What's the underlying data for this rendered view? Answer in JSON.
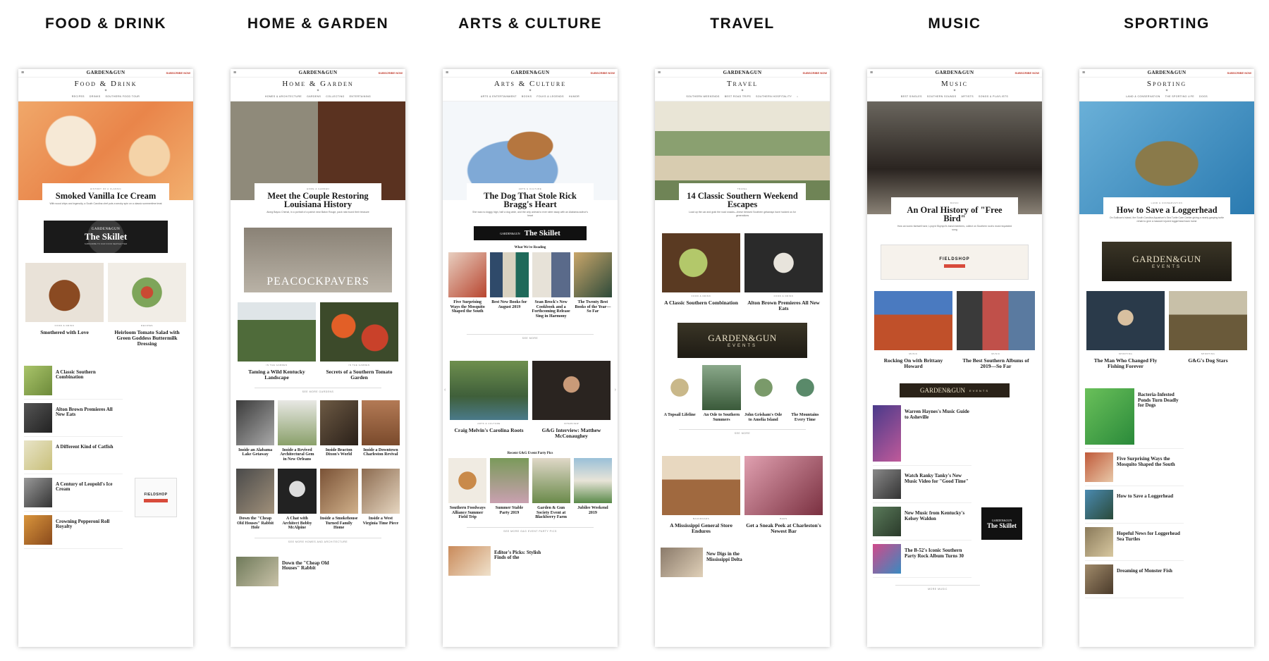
{
  "categories": [
    "FOOD & DRINK",
    "HOME & GARDEN",
    "ARTS & CULTURE",
    "TRAVEL",
    "MUSIC",
    "SPORTING"
  ],
  "brand": {
    "logo": "GARDEN&GUN",
    "subscribe": "SUBSCRIBE NOW",
    "menu": "≡"
  },
  "food": {
    "section": "Food & Drink",
    "subnav": [
      "RECIPES",
      "DRINKS",
      "SOUTHERN FOOD TOUR"
    ],
    "hero_kicker": "HISTORY OF A CLASSIC",
    "hero_title": "Smoked Vanilla Ice Cream",
    "hero_dek": "With wood chips and ingenuity, a South Carolina chef puts a smoky spin on a classic summertime treat",
    "ad_top": "GARDEN&GUN",
    "ad_main": "The Skillet",
    "ad_sub": "SUBSCRIBE TO OUR FOOD NEWSLETTER",
    "tile1_title": "Smothered with Love",
    "tile1_kicker": "FOOD & DRINK",
    "tile2_title": "Heirloom Tomato Salad with Green Goddess Buttermilk Dressing",
    "tile2_kicker": "RECIPES",
    "side_ad": "FIELDSHOP",
    "list": [
      "A Classic Southern Combination",
      "Alton Brown Premieres All New Eats",
      "A Different Kind of Catfish",
      "A Century of Leopold's Ice Cream",
      "Crowning Pepperoni Roll Royalty"
    ]
  },
  "home": {
    "section": "Home & Garden",
    "subnav": [
      "HOMES & ARCHITECTURE",
      "GARDENS",
      "COLLECTING",
      "ENTERTAINING"
    ],
    "hero_kicker": "HOME & GARDEN",
    "hero_title": "Meet the Couple Restoring Louisiana History",
    "hero_dek": "Along Bayou Chenal, in a portrait of a parish near Baton Rouge, pack rats found their treasure",
    "ad_text": "PEACOCKPAVERS",
    "tile1_title": "Taming a Wild Kentucky Landscape",
    "tile1_kicker": "IN THE GARDEN",
    "tile2_title": "Secrets of a Southern Tomato Garden",
    "tile2_kicker": "IN THE GARDEN",
    "more1": "SEE MORE GARDENS",
    "row1": [
      "Inside an Alabama Lake Getaway",
      "Inside a Revived Architectural Gem in New Orleans",
      "Inside Bracton Dixon's World",
      "Inside a Downtown Charleston Revival"
    ],
    "row2": [
      "Down the \"Cheap Old Houses\" Rabbit Hole",
      "A Chat with Architect Bobby McAlpine",
      "Inside a Smokehouse Turned Family Home",
      "Inside a West Virginia Time Piece"
    ],
    "more2": "SEE MORE HOMES AND ARCHITECTURE",
    "bottom_title": "Down the \"Cheap Old Houses\" Rabbit"
  },
  "arts": {
    "section": "Arts & Culture",
    "subnav": [
      "ARTS & ENTERTAINMENT",
      "BOOKS",
      "FOLKS & LEGENDS",
      "HUMOR"
    ],
    "hero_kicker": "ARTS & CULTURE",
    "hero_title": "The Dog That Stole Rick Bragg's Heart",
    "hero_dek": "She was no doggy high, half a dog wide, and the only animal to ever steer away with an Alabama author's heart",
    "ad_top": "GARDEN&GUN",
    "ad_main": "The Skillet",
    "reading_label": "What We're Reading",
    "reading": [
      "Five Surprising Ways the Mosquito Shaped the South",
      "Best New Books for August 2019",
      "Sean Brock's New Cookbook and a Forthcoming Release Sing in Harmony",
      "The Twenty Best Books of the Year—So Far"
    ],
    "see_more": "SEE MORE",
    "tile1_title": "Craig Melvin's Carolina Roots",
    "tile1_kicker": "ARTS & CULTURE",
    "tile2_title": "G&G Interview: Matthew McConaughey",
    "tile2_kicker": "INTERVIEW",
    "party_label": "Recent G&G Event Party Pics",
    "party": [
      "Southern Foodways Alliance Summer Field Trip",
      "Summer Stable Party 2019",
      "Garden & Gun Society Event at Blackberry Farm",
      "Jubilee Weekend 2019"
    ],
    "more2": "SEE MORE G&G EVENT PARTY PICS",
    "bottom_title": "Editor's Picks: Stylish Finds of the"
  },
  "travel": {
    "section": "Travel",
    "subnav": [
      "SOUTHERN WEEKENDS",
      "BEST ROAD TRIPS",
      "SOUTHERN HOSPITALITY"
    ],
    "hero_kicker": "TRAVEL",
    "hero_title": "14 Classic Southern Weekend Escapes",
    "hero_dek": "Load up the car and grab the road snacks—these beloved Southern getaways have hooked us for generations",
    "tile1_title": "A Classic Southern Combination",
    "tile1_kicker": "FOOD & DRINK",
    "tile2_title": "Alton Brown Premieres All New Eats",
    "tile2_kicker": "FOOD & DRINK",
    "events_1": "GARDEN&GUN",
    "events_2": "EVENTS",
    "row": [
      "A Topsail Lifeline",
      "An Ode to Southern Summers",
      "John Grisham's Ode to Amelia Island",
      "The Mountains Every Time"
    ],
    "more": "SEE MORE",
    "tile3_title": "A Mississippi General Store Endures",
    "tile3_kicker": "BACKROADS",
    "tile4_title": "Get a Sneak Peek at Charleston's Newest Bar",
    "tile4_kicker": "BARS",
    "bottom_title": "New Digs in the Mississippi Delta"
  },
  "music": {
    "section": "Music",
    "subnav": [
      "BEST SINGLES",
      "SOUTHERN SOUNDS",
      "ARTISTS",
      "SONGS & PLAYLISTS"
    ],
    "hero_kicker": "MUSIC",
    "hero_title": "An Oral History of \"Free Bird\"",
    "hero_dek": "How an iconic farewell tune, Lynyrd Skynyrd's band members, collect on Southern rock's most requested song",
    "side_ad": "FIELDSHOP",
    "tile1_title": "Rocking On with Brittany Howard",
    "tile1_kicker": "MUSIC",
    "tile2_title": "The Best Southern Albums of 2019—So Far",
    "tile2_kicker": "MUSIC",
    "events_1": "GARDEN&GUN",
    "events_2": "EVENTS",
    "list": [
      "Warren Haynes's Music Guide to Asheville",
      "Watch Ranky Tanky's New Music Video for \"Good Time\"",
      "New Music from Kentucky's Kelsey Waldon",
      "The B-52's Iconic Southern Party Rock Album Turns 30"
    ],
    "skillet": "The Skillet",
    "more": "MORE MUSIC"
  },
  "sporting": {
    "section": "Sporting",
    "subnav": [
      "LAND & CONSERVATION",
      "THE SPORTING LIFE",
      "DOGS"
    ],
    "hero_kicker": "LAND & CONSERVATION",
    "hero_title": "How to Save a Loggerhead",
    "hero_dek": "On Sullivan's Island, the South Carolina Aquarium's Sea Turtle Care Center giving a nearly gasping turtle rehab to give a massive injured loggerhead back home",
    "events_1": "GARDEN&GUN",
    "events_2": "EVENTS",
    "tile1_title": "The Man Who Changed Fly Fishing Forever",
    "tile1_kicker": "SPORTING",
    "tile2_title": "G&G's Dog Stars",
    "tile2_kicker": "SPORTING",
    "list": [
      "Bacteria-Infested Ponds Turn Deadly for Dogs",
      "Five Surprising Ways the Mosquito Shaped the South",
      "How to Save a Loggerhead",
      "Hopeful News for Loggerhead Sea Turtles",
      "Dreaming of Monster Fish"
    ]
  }
}
